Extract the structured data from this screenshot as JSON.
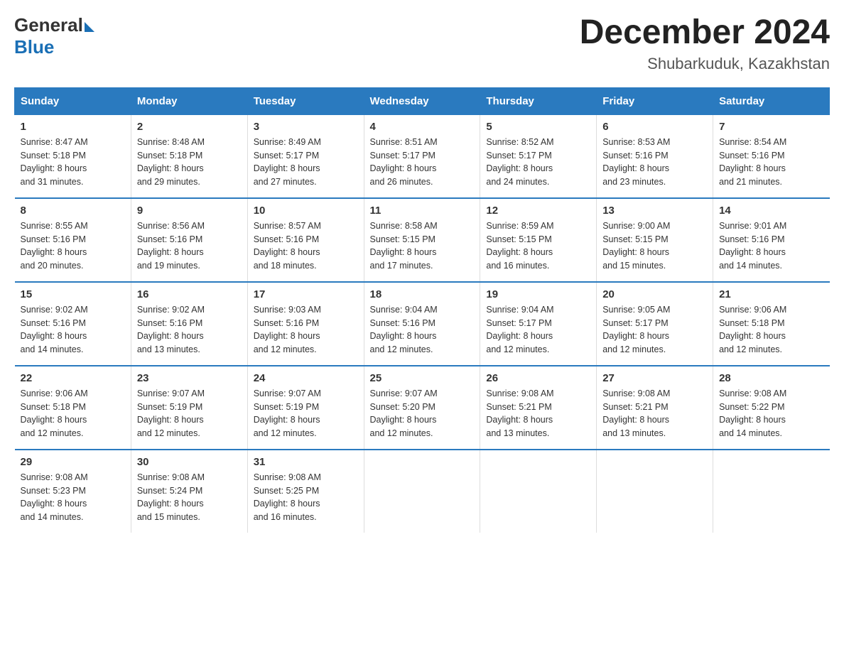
{
  "logo": {
    "general": "General",
    "blue": "Blue"
  },
  "header": {
    "month_year": "December 2024",
    "location": "Shubarkuduk, Kazakhstan"
  },
  "weekdays": [
    "Sunday",
    "Monday",
    "Tuesday",
    "Wednesday",
    "Thursday",
    "Friday",
    "Saturday"
  ],
  "weeks": [
    [
      {
        "day": "1",
        "sunrise": "8:47 AM",
        "sunset": "5:18 PM",
        "daylight": "8 hours and 31 minutes."
      },
      {
        "day": "2",
        "sunrise": "8:48 AM",
        "sunset": "5:18 PM",
        "daylight": "8 hours and 29 minutes."
      },
      {
        "day": "3",
        "sunrise": "8:49 AM",
        "sunset": "5:17 PM",
        "daylight": "8 hours and 27 minutes."
      },
      {
        "day": "4",
        "sunrise": "8:51 AM",
        "sunset": "5:17 PM",
        "daylight": "8 hours and 26 minutes."
      },
      {
        "day": "5",
        "sunrise": "8:52 AM",
        "sunset": "5:17 PM",
        "daylight": "8 hours and 24 minutes."
      },
      {
        "day": "6",
        "sunrise": "8:53 AM",
        "sunset": "5:16 PM",
        "daylight": "8 hours and 23 minutes."
      },
      {
        "day": "7",
        "sunrise": "8:54 AM",
        "sunset": "5:16 PM",
        "daylight": "8 hours and 21 minutes."
      }
    ],
    [
      {
        "day": "8",
        "sunrise": "8:55 AM",
        "sunset": "5:16 PM",
        "daylight": "8 hours and 20 minutes."
      },
      {
        "day": "9",
        "sunrise": "8:56 AM",
        "sunset": "5:16 PM",
        "daylight": "8 hours and 19 minutes."
      },
      {
        "day": "10",
        "sunrise": "8:57 AM",
        "sunset": "5:16 PM",
        "daylight": "8 hours and 18 minutes."
      },
      {
        "day": "11",
        "sunrise": "8:58 AM",
        "sunset": "5:15 PM",
        "daylight": "8 hours and 17 minutes."
      },
      {
        "day": "12",
        "sunrise": "8:59 AM",
        "sunset": "5:15 PM",
        "daylight": "8 hours and 16 minutes."
      },
      {
        "day": "13",
        "sunrise": "9:00 AM",
        "sunset": "5:15 PM",
        "daylight": "8 hours and 15 minutes."
      },
      {
        "day": "14",
        "sunrise": "9:01 AM",
        "sunset": "5:16 PM",
        "daylight": "8 hours and 14 minutes."
      }
    ],
    [
      {
        "day": "15",
        "sunrise": "9:02 AM",
        "sunset": "5:16 PM",
        "daylight": "8 hours and 14 minutes."
      },
      {
        "day": "16",
        "sunrise": "9:02 AM",
        "sunset": "5:16 PM",
        "daylight": "8 hours and 13 minutes."
      },
      {
        "day": "17",
        "sunrise": "9:03 AM",
        "sunset": "5:16 PM",
        "daylight": "8 hours and 12 minutes."
      },
      {
        "day": "18",
        "sunrise": "9:04 AM",
        "sunset": "5:16 PM",
        "daylight": "8 hours and 12 minutes."
      },
      {
        "day": "19",
        "sunrise": "9:04 AM",
        "sunset": "5:17 PM",
        "daylight": "8 hours and 12 minutes."
      },
      {
        "day": "20",
        "sunrise": "9:05 AM",
        "sunset": "5:17 PM",
        "daylight": "8 hours and 12 minutes."
      },
      {
        "day": "21",
        "sunrise": "9:06 AM",
        "sunset": "5:18 PM",
        "daylight": "8 hours and 12 minutes."
      }
    ],
    [
      {
        "day": "22",
        "sunrise": "9:06 AM",
        "sunset": "5:18 PM",
        "daylight": "8 hours and 12 minutes."
      },
      {
        "day": "23",
        "sunrise": "9:07 AM",
        "sunset": "5:19 PM",
        "daylight": "8 hours and 12 minutes."
      },
      {
        "day": "24",
        "sunrise": "9:07 AM",
        "sunset": "5:19 PM",
        "daylight": "8 hours and 12 minutes."
      },
      {
        "day": "25",
        "sunrise": "9:07 AM",
        "sunset": "5:20 PM",
        "daylight": "8 hours and 12 minutes."
      },
      {
        "day": "26",
        "sunrise": "9:08 AM",
        "sunset": "5:21 PM",
        "daylight": "8 hours and 13 minutes."
      },
      {
        "day": "27",
        "sunrise": "9:08 AM",
        "sunset": "5:21 PM",
        "daylight": "8 hours and 13 minutes."
      },
      {
        "day": "28",
        "sunrise": "9:08 AM",
        "sunset": "5:22 PM",
        "daylight": "8 hours and 14 minutes."
      }
    ],
    [
      {
        "day": "29",
        "sunrise": "9:08 AM",
        "sunset": "5:23 PM",
        "daylight": "8 hours and 14 minutes."
      },
      {
        "day": "30",
        "sunrise": "9:08 AM",
        "sunset": "5:24 PM",
        "daylight": "8 hours and 15 minutes."
      },
      {
        "day": "31",
        "sunrise": "9:08 AM",
        "sunset": "5:25 PM",
        "daylight": "8 hours and 16 minutes."
      },
      null,
      null,
      null,
      null
    ]
  ],
  "labels": {
    "sunrise": "Sunrise:",
    "sunset": "Sunset:",
    "daylight": "Daylight:"
  }
}
